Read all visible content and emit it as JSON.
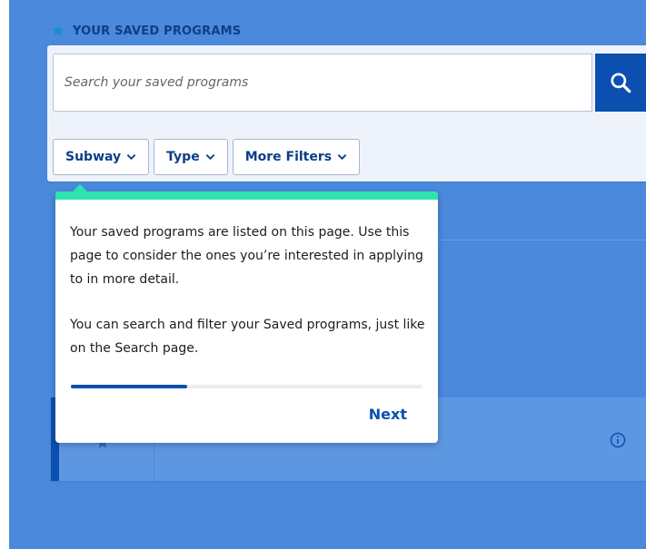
{
  "colors": {
    "background": "#4a89dc",
    "panel": "#eef3fb",
    "primary": "#0b4fb1",
    "heading": "#0d3f86",
    "tooltip_accent": "#2ee3b0"
  },
  "heading": {
    "icon": "star-icon",
    "label": "YOUR SAVED PROGRAMS"
  },
  "search": {
    "placeholder": "Search your saved programs",
    "button_icon": "search-icon"
  },
  "filters": [
    {
      "label": "Subway",
      "icon": "chevron-down-icon"
    },
    {
      "label": "Type",
      "icon": "chevron-down-icon"
    },
    {
      "label": "More Filters",
      "icon": "chevron-down-icon"
    }
  ],
  "tooltip": {
    "paragraphs": [
      "Your saved programs are listed on this page. Use this page to consider the ones you’re interested in applying to in more detail.",
      "You can search and filter your Saved programs, just like on the Search page."
    ],
    "progress": 0.33,
    "next_label": "Next"
  },
  "card": {
    "star_icon": "star-outline-icon",
    "info_icon": "info-icon"
  }
}
